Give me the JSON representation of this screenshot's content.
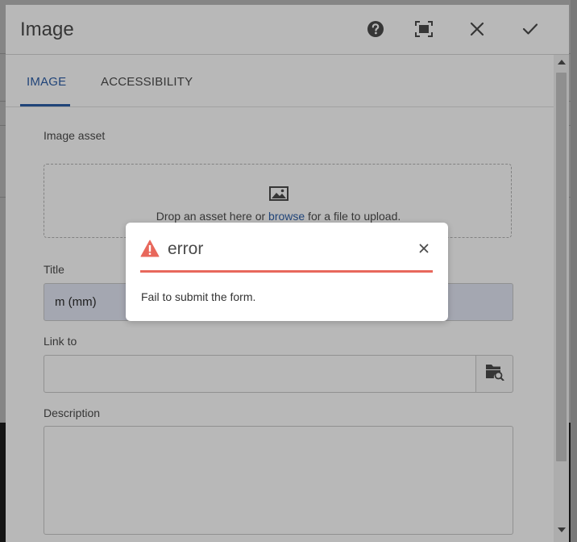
{
  "dialog": {
    "title": "Image",
    "actions": {
      "help_icon": "help-icon",
      "fullscreen_icon": "fullscreen-icon",
      "close_icon": "close-icon",
      "done_icon": "checkmark-icon"
    }
  },
  "tabs": [
    {
      "label": "IMAGE",
      "active": true
    },
    {
      "label": "ACCESSIBILITY",
      "active": false
    }
  ],
  "form": {
    "image_asset": {
      "label": "Image asset",
      "drop_prefix": "Drop an asset here or ",
      "browse_link": "browse",
      "drop_suffix": " for a file to upload.",
      "icon": "image-icon"
    },
    "title": {
      "label": "Title",
      "value": "m (mm)"
    },
    "link_to": {
      "label": "Link to",
      "value": "",
      "browse_icon": "folder-search-icon"
    },
    "description": {
      "label": "Description",
      "value": ""
    }
  },
  "alert": {
    "title": "error",
    "message": "Fail to submit the form.",
    "icon": "alert-triangle-icon",
    "close_icon": "close-icon",
    "accent_color": "#e8685c"
  },
  "colors": {
    "accent": "#2d5fa8",
    "title_field_bg": "#e3e8f6"
  }
}
